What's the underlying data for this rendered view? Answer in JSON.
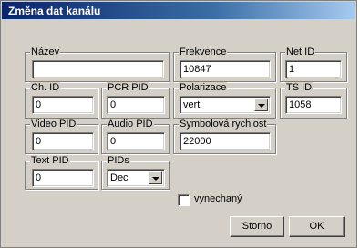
{
  "window": {
    "title": "Změna dat kanálu"
  },
  "fields": {
    "nazev": {
      "label": "Název",
      "value": ""
    },
    "frekvence": {
      "label": "Frekvence",
      "value": "10847"
    },
    "net_id": {
      "label": "Net ID",
      "value": "1"
    },
    "ch_id": {
      "label": "Ch. ID",
      "value": "0"
    },
    "pcr_pid": {
      "label": "PCR PID",
      "value": "0"
    },
    "polarizace": {
      "label": "Polarizace",
      "value": "vert"
    },
    "ts_id": {
      "label": "TS ID",
      "value": "1058"
    },
    "video_pid": {
      "label": "Video PID",
      "value": "0"
    },
    "audio_pid": {
      "label": "Audio PID",
      "value": "0"
    },
    "symbolova_rychlost": {
      "label": "Symbolová rychlost",
      "value": "22000"
    },
    "text_pid": {
      "label": "Text PID",
      "value": "0"
    },
    "pids": {
      "label": "PIDs",
      "value": "Dec"
    }
  },
  "checkbox": {
    "label": "vynechaný",
    "checked": false
  },
  "buttons": {
    "cancel": "Storno",
    "ok": "OK"
  }
}
